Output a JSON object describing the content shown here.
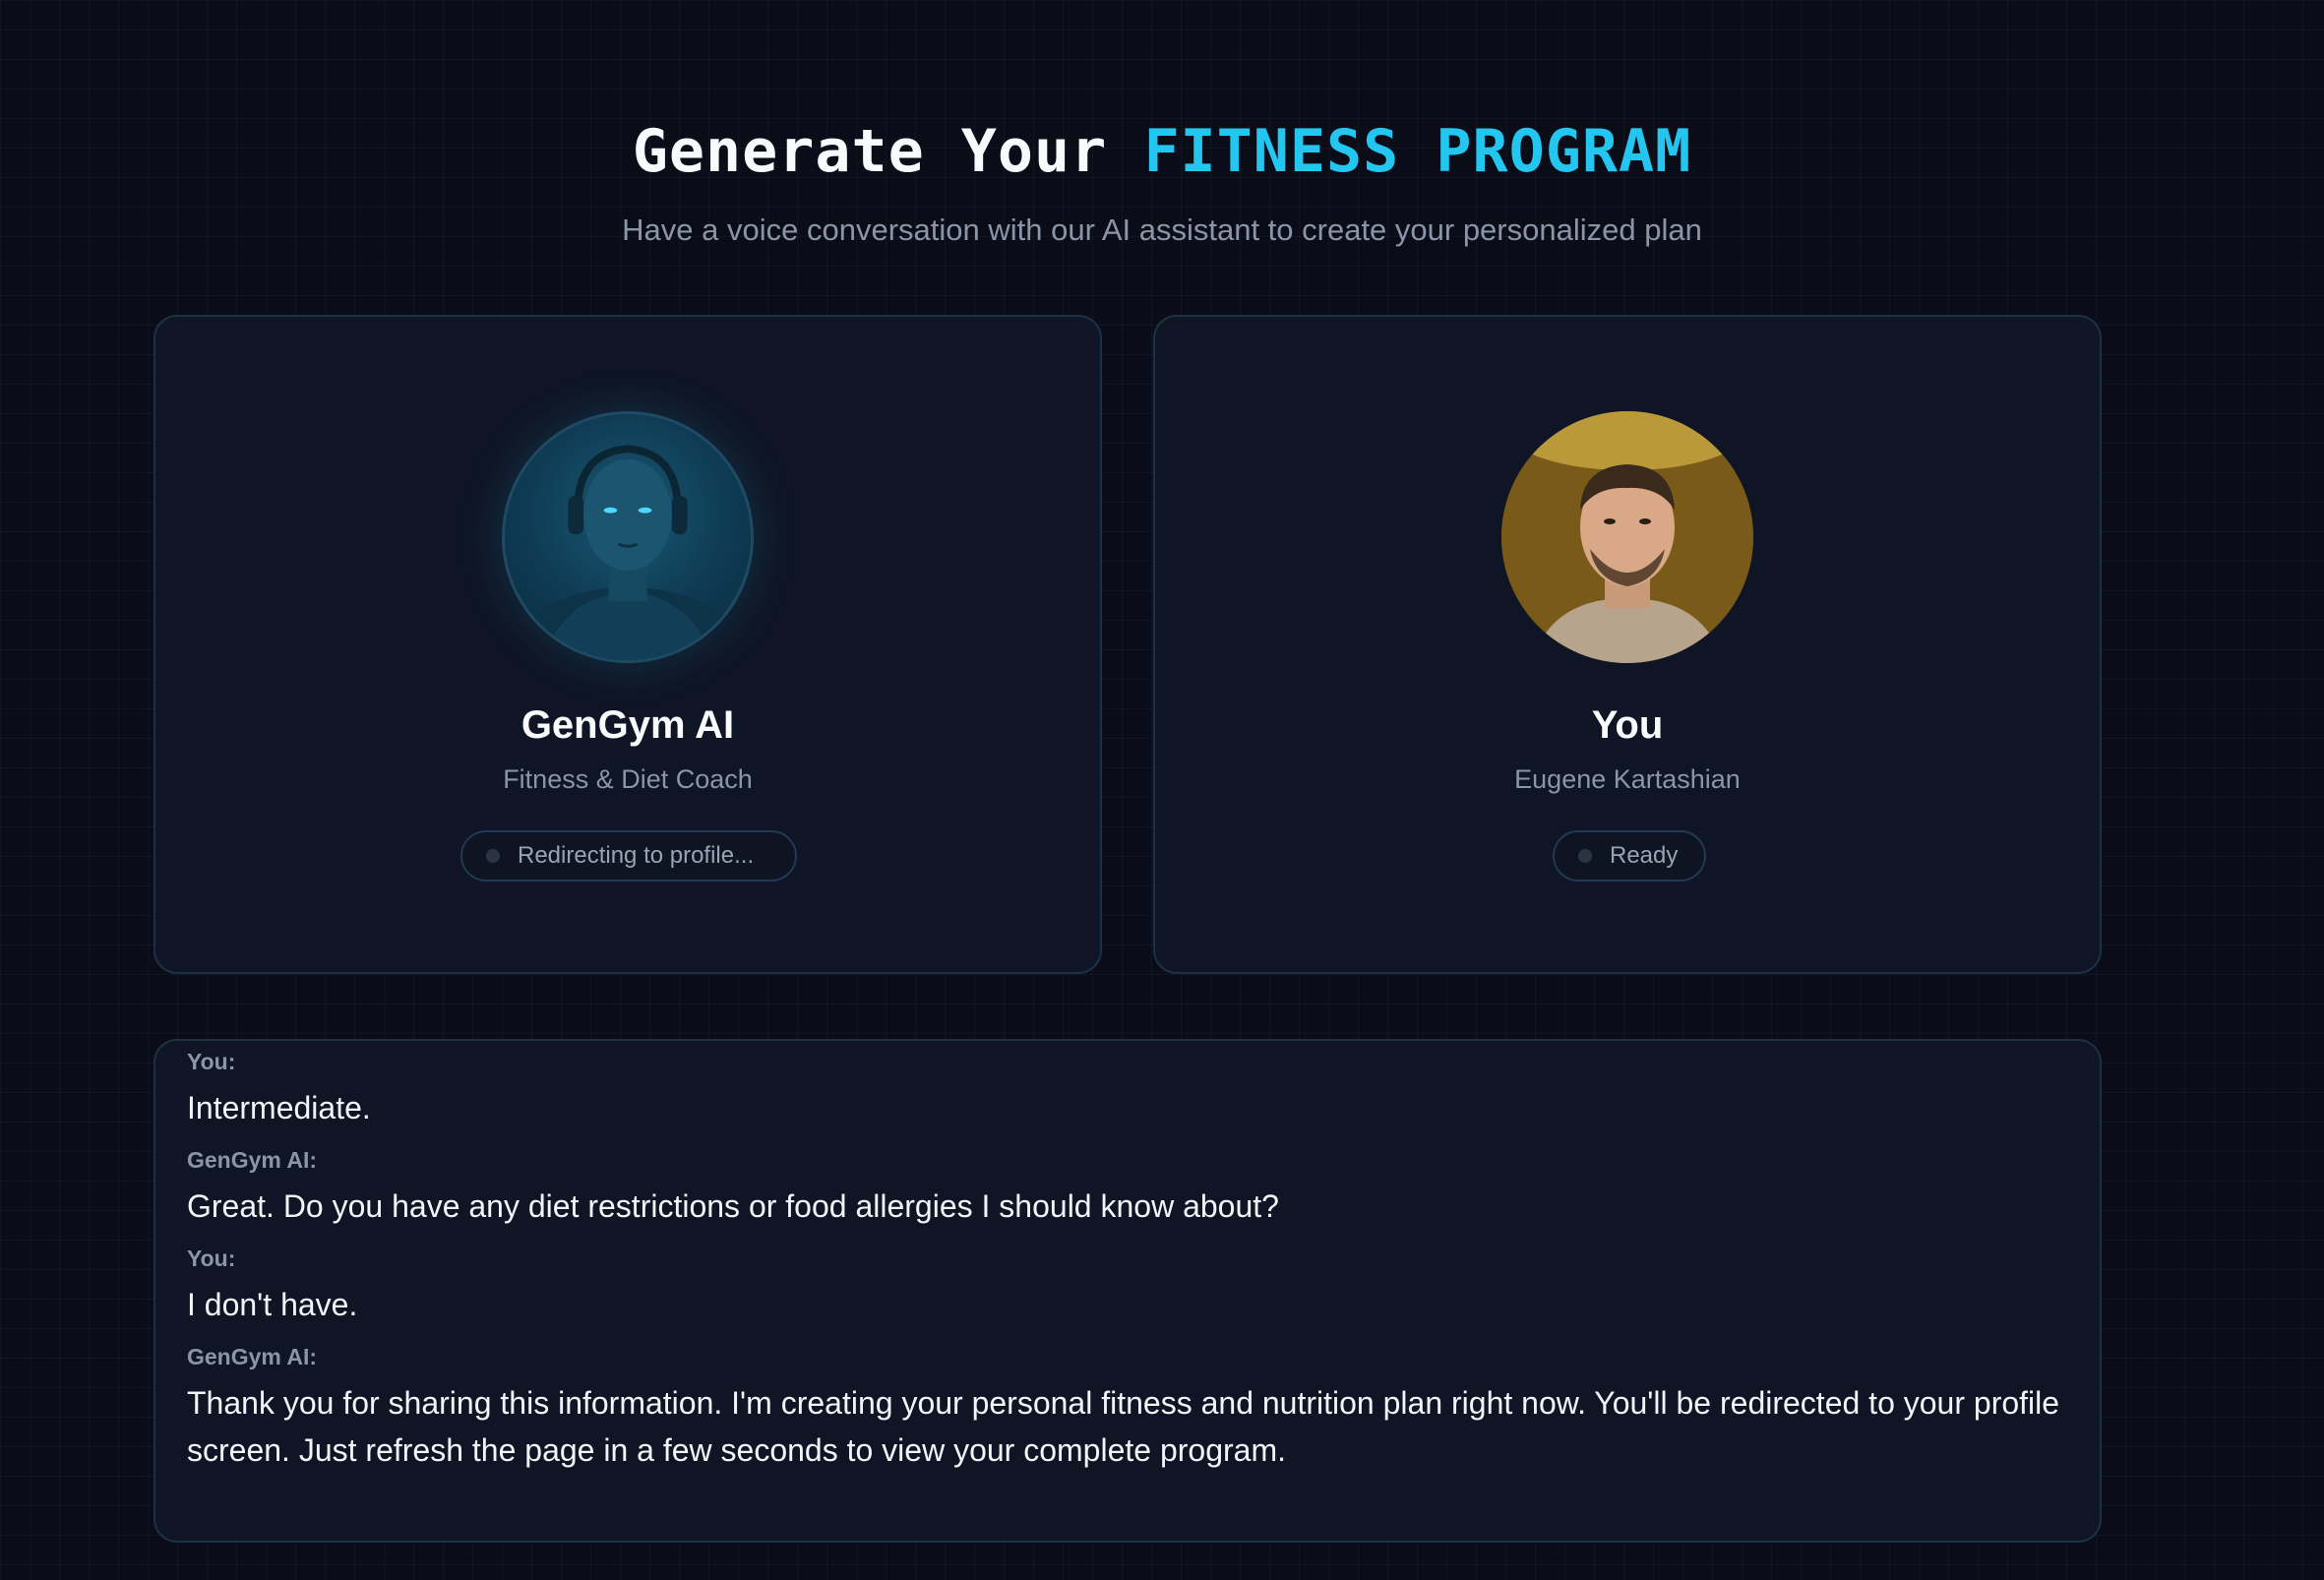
{
  "header": {
    "title_prefix": "Generate Your",
    "title_accent": "FITNESS PROGRAM",
    "subtitle": "Have a voice conversation with our AI assistant to create your personalized plan"
  },
  "ai_card": {
    "name": "GenGym AI",
    "role": "Fitness & Diet Coach",
    "status": "Redirecting to profile..."
  },
  "user_card": {
    "name": "You",
    "role": "Eugene Kartashian",
    "status": "Ready"
  },
  "transcript": {
    "messages": [
      {
        "speaker": "You:",
        "text": "Intermediate."
      },
      {
        "speaker": "GenGym AI:",
        "text": "Great. Do you have any diet restrictions or food allergies I should know about?"
      },
      {
        "speaker": "You:",
        "text": "I don't have."
      },
      {
        "speaker": "GenGym AI:",
        "text": "Thank you for sharing this information. I'm creating your personal fitness and nutrition plan right now. You'll be redirected to your profile screen. Just refresh the page in a few seconds to view your complete program."
      }
    ]
  },
  "colors": {
    "accent": "#22c6ef",
    "background": "#0a0d17",
    "card": "#0f1524",
    "border": "#1c3147"
  }
}
